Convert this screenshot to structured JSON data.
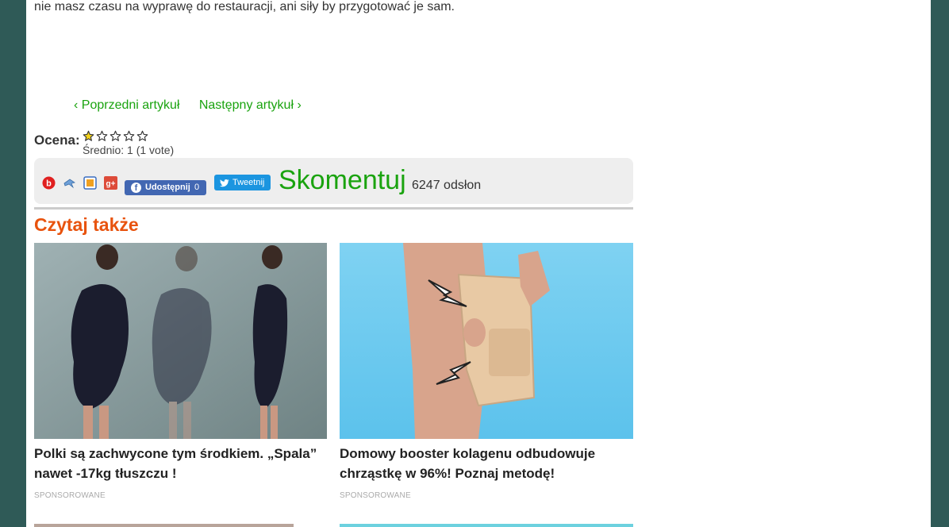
{
  "article": {
    "intro_text": "nie masz czasu na wyprawę do restauracji, ani siły by przygotować je sam."
  },
  "nav": {
    "prev_label": "‹ Poprzedni artykuł",
    "next_label": "Następny artykuł ›"
  },
  "rating": {
    "label": "Ocena:",
    "value": 1,
    "max": 5,
    "average_text": "Średnio: 1 (1 vote)"
  },
  "share": {
    "icons": [
      "blip-icon",
      "wykop-icon",
      "facebook-alt-icon",
      "google-plus-icon"
    ],
    "facebook": {
      "label": "Udostępnij",
      "count": "0"
    },
    "twitter": {
      "label": "Tweetnij"
    },
    "comment_label": "Skomentuj",
    "views_text": "6247 odsłon"
  },
  "read_also": {
    "title": "Czytaj także",
    "items": [
      {
        "title": "Polki są zachwycone tym środkiem. „Spala” nawet -17kg tłuszczu !",
        "sponsor": "SPONSOROWANE"
      },
      {
        "title": "Domowy booster kolagenu odbudowuje chrząstkę w 96%! Poznaj metodę!",
        "sponsor": "SPONSOROWANE"
      }
    ]
  },
  "colors": {
    "background": "#2f5a57",
    "link_green": "#1aa30f",
    "section_orange": "#e8530e",
    "facebook_blue": "#4267b2",
    "twitter_blue": "#1b95e0"
  }
}
